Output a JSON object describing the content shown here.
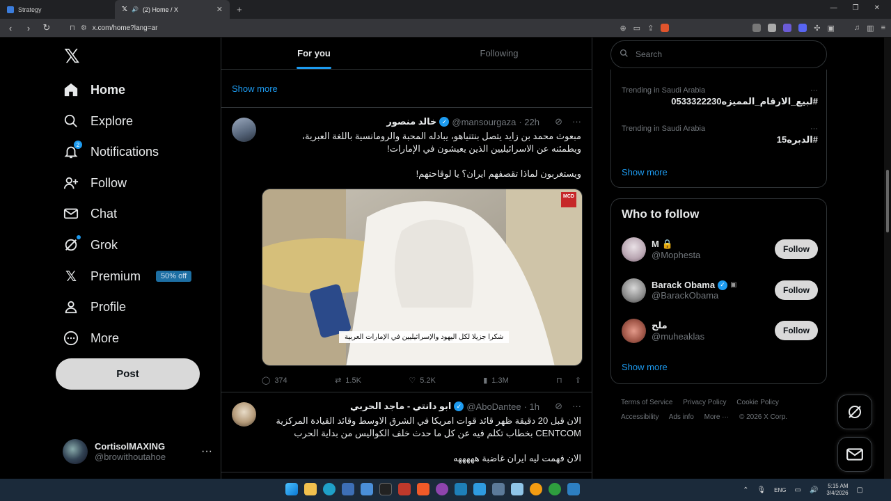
{
  "browser": {
    "tabs": [
      {
        "label": "Strategy"
      },
      {
        "label": "(2) Home / X"
      }
    ],
    "url": "x.com/home?lang=ar"
  },
  "nav": {
    "items": [
      {
        "label": "Home",
        "icon": "home-icon"
      },
      {
        "label": "Explore",
        "icon": "search-icon"
      },
      {
        "label": "Notifications",
        "icon": "bell-icon",
        "badge": "2"
      },
      {
        "label": "Follow",
        "icon": "person-plus-icon"
      },
      {
        "label": "Chat",
        "icon": "mail-icon"
      },
      {
        "label": "Grok",
        "icon": "grok-icon"
      },
      {
        "label": "Premium",
        "icon": "x-logo-icon",
        "pill": "50% off"
      },
      {
        "label": "Profile",
        "icon": "person-icon"
      },
      {
        "label": "More",
        "icon": "more-circle-icon"
      }
    ],
    "post_label": "Post",
    "user": {
      "name": "CortisolMAXING",
      "handle": "@browithoutahoe"
    }
  },
  "feed": {
    "tabs": [
      "For you",
      "Following"
    ],
    "show_more": "Show more",
    "tweets": [
      {
        "name": "خالد منصور",
        "handle": "@mansourgaza",
        "time": "· 22h",
        "lines": [
          "مبعوث محمد بن زايد يتصل بنتنياهو، يبادله المحبة والرومانسية باللغة العبرية،",
          "ويطمئنه عن الاسرائيليين الذين يعيشون في الإمارات!",
          "",
          "ويستغربون لماذا تقصفهم ايران؟ يا لوقاحتهم!"
        ],
        "caption": "شكرا جزيلا لكل اليهود والإسرائيليين في الإمارات العربية",
        "media_badge": "MCD",
        "replies": "374",
        "reposts": "1.5K",
        "likes": "5.2K",
        "views": "1.3M"
      },
      {
        "name": "ابو دانتي - ماجد الحربي",
        "handle": "@AboDantee",
        "time": "· 1h",
        "lines": [
          "الان قبل 20 دقيقة ظهر قائد قوات امريكا في الشرق الاوسط وقائد القيادة المركزية",
          "CENTCOM بخطاب تكلم فيه عن كل ما حدث خلف الكواليس من بداية الحرب",
          "",
          "الان فهمت ليه ايران غاضبة هههههه"
        ]
      }
    ]
  },
  "sidebar": {
    "search_placeholder": "Search",
    "trends": [
      {
        "meta": "Trending in Saudi Arabia",
        "tag": "#لبيع_الارقام_المميزه0533322230"
      },
      {
        "meta": "Trending in Saudi Arabia",
        "tag": "#الدبره15"
      }
    ],
    "trends_show_more": "Show more",
    "who_to_follow_title": "Who to follow",
    "suggestions": [
      {
        "name": "M",
        "handle": "@Mophesta",
        "follow": "Follow"
      },
      {
        "name": "Barack Obama",
        "handle": "@BarackObama",
        "follow": "Follow"
      },
      {
        "name": "ملح",
        "handle": "@muheaklas",
        "follow": "Follow"
      }
    ],
    "wtf_show_more": "Show more",
    "footer": [
      "Terms of Service",
      "Privacy Policy",
      "Cookie Policy",
      "Accessibility",
      "Ads info",
      "More ···",
      "© 2026 X Corp."
    ]
  },
  "taskbar": {
    "lang": "ENG",
    "time": "5:15 AM",
    "date": "3/4/2026"
  },
  "colors": {
    "accent": "#1d9bf0",
    "background": "#000000",
    "border": "#2f3336",
    "muted": "#71767b"
  }
}
